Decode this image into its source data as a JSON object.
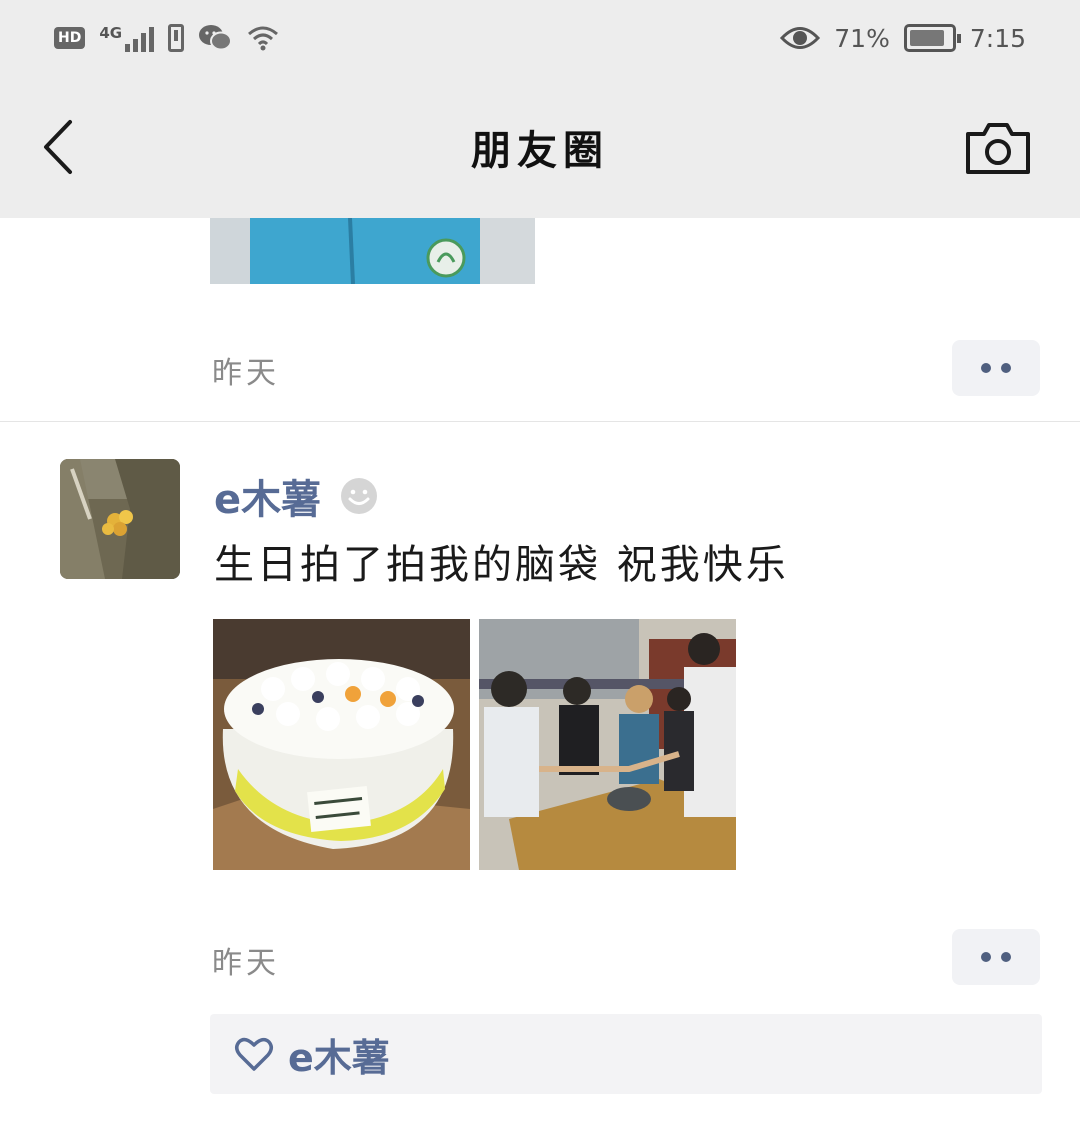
{
  "status_bar": {
    "hd": "HD",
    "network": "4G",
    "battery_percent": "71%",
    "time": "7:15"
  },
  "nav": {
    "title": "朋友圈"
  },
  "previous_post": {
    "time": "昨天"
  },
  "post": {
    "author": "e木薯",
    "text": "生日拍了拍我的脑袋 祝我快乐",
    "time": "昨天",
    "photos": [
      "birthday-cake-photo",
      "friends-toasting-photo"
    ],
    "likes": [
      "e木薯"
    ]
  },
  "colors": {
    "link": "#576b95",
    "nav_bg": "#ededed",
    "like_bg": "#f3f3f5"
  }
}
